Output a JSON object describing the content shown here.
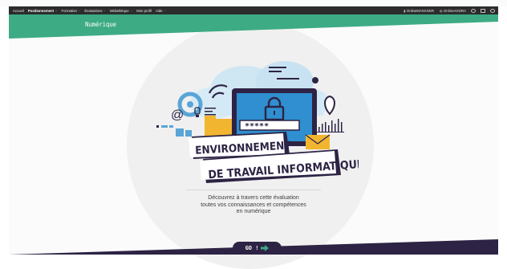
{
  "nav": {
    "items": [
      {
        "label": "Accueil",
        "active": false,
        "dropdown": false
      },
      {
        "label": "Positionnement",
        "active": true,
        "dropdown": true
      },
      {
        "label": "Formation",
        "active": false,
        "dropdown": true
      },
      {
        "label": "Évaluations",
        "active": false,
        "dropdown": true
      },
      {
        "label": "Métiathèque",
        "active": false,
        "dropdown": true
      },
      {
        "label": "Mon profil",
        "active": false,
        "dropdown": false
      },
      {
        "label": "Aide",
        "active": false,
        "dropdown": true
      }
    ],
    "right": {
      "manager_label": "OnlineMANAGER",
      "agora_label": "OnlineAGORA",
      "icons": [
        "chat-icon",
        "message-icon",
        "power-icon"
      ]
    }
  },
  "header": {
    "subtitle": "Numérique",
    "color": "#3dab84"
  },
  "illustration": {
    "password_field": "*****",
    "title_line1": "ENVIRONNEMENT",
    "title_line2": "DE TRAVAIL INFORMATIQUE",
    "icons": [
      "lock-icon",
      "cloud-icon",
      "location-pin-icon",
      "wifi-icon",
      "at-sign-icon",
      "folder-icon",
      "envelope-icon",
      "bar-chart-icon",
      "gear-icon",
      "lightbulb-icon",
      "person-icon"
    ]
  },
  "description": {
    "line1": "Découvrez à travers cette évaluation",
    "line2": "toutes vos connaissances et compétences",
    "line3": "en numérique"
  },
  "go_button": {
    "label": "GO !",
    "arrow_color": "#3dab84",
    "bg_color": "#2d2344"
  }
}
